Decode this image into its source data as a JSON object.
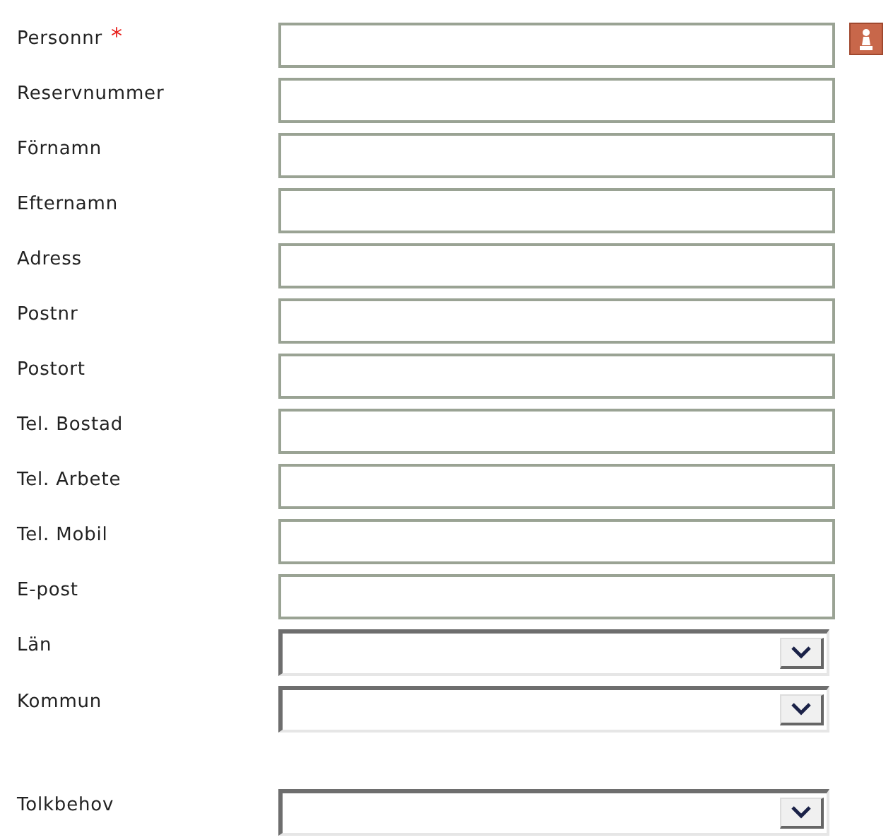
{
  "sections": [
    {
      "fields": [
        {
          "kind": "text",
          "label": "Personnr",
          "required_mark": "*",
          "lookup_button": true
        },
        {
          "kind": "text",
          "label": "Reservnummer"
        },
        {
          "kind": "text",
          "label": "Förnamn"
        },
        {
          "kind": "text",
          "label": "Efternamn"
        },
        {
          "kind": "text",
          "label": "Adress"
        },
        {
          "kind": "text",
          "label": "Postnr"
        },
        {
          "kind": "text",
          "label": "Postort"
        },
        {
          "kind": "text",
          "label": "Tel. Bostad"
        },
        {
          "kind": "text",
          "label": "Tel. Arbete"
        },
        {
          "kind": "text",
          "label": "Tel. Mobil"
        },
        {
          "kind": "text",
          "label": "E-post"
        },
        {
          "kind": "select",
          "label": "Län"
        },
        {
          "kind": "select",
          "label": "Kommun"
        }
      ]
    },
    {
      "fields": [
        {
          "kind": "select",
          "label": "Tolkbehov"
        }
      ]
    }
  ]
}
